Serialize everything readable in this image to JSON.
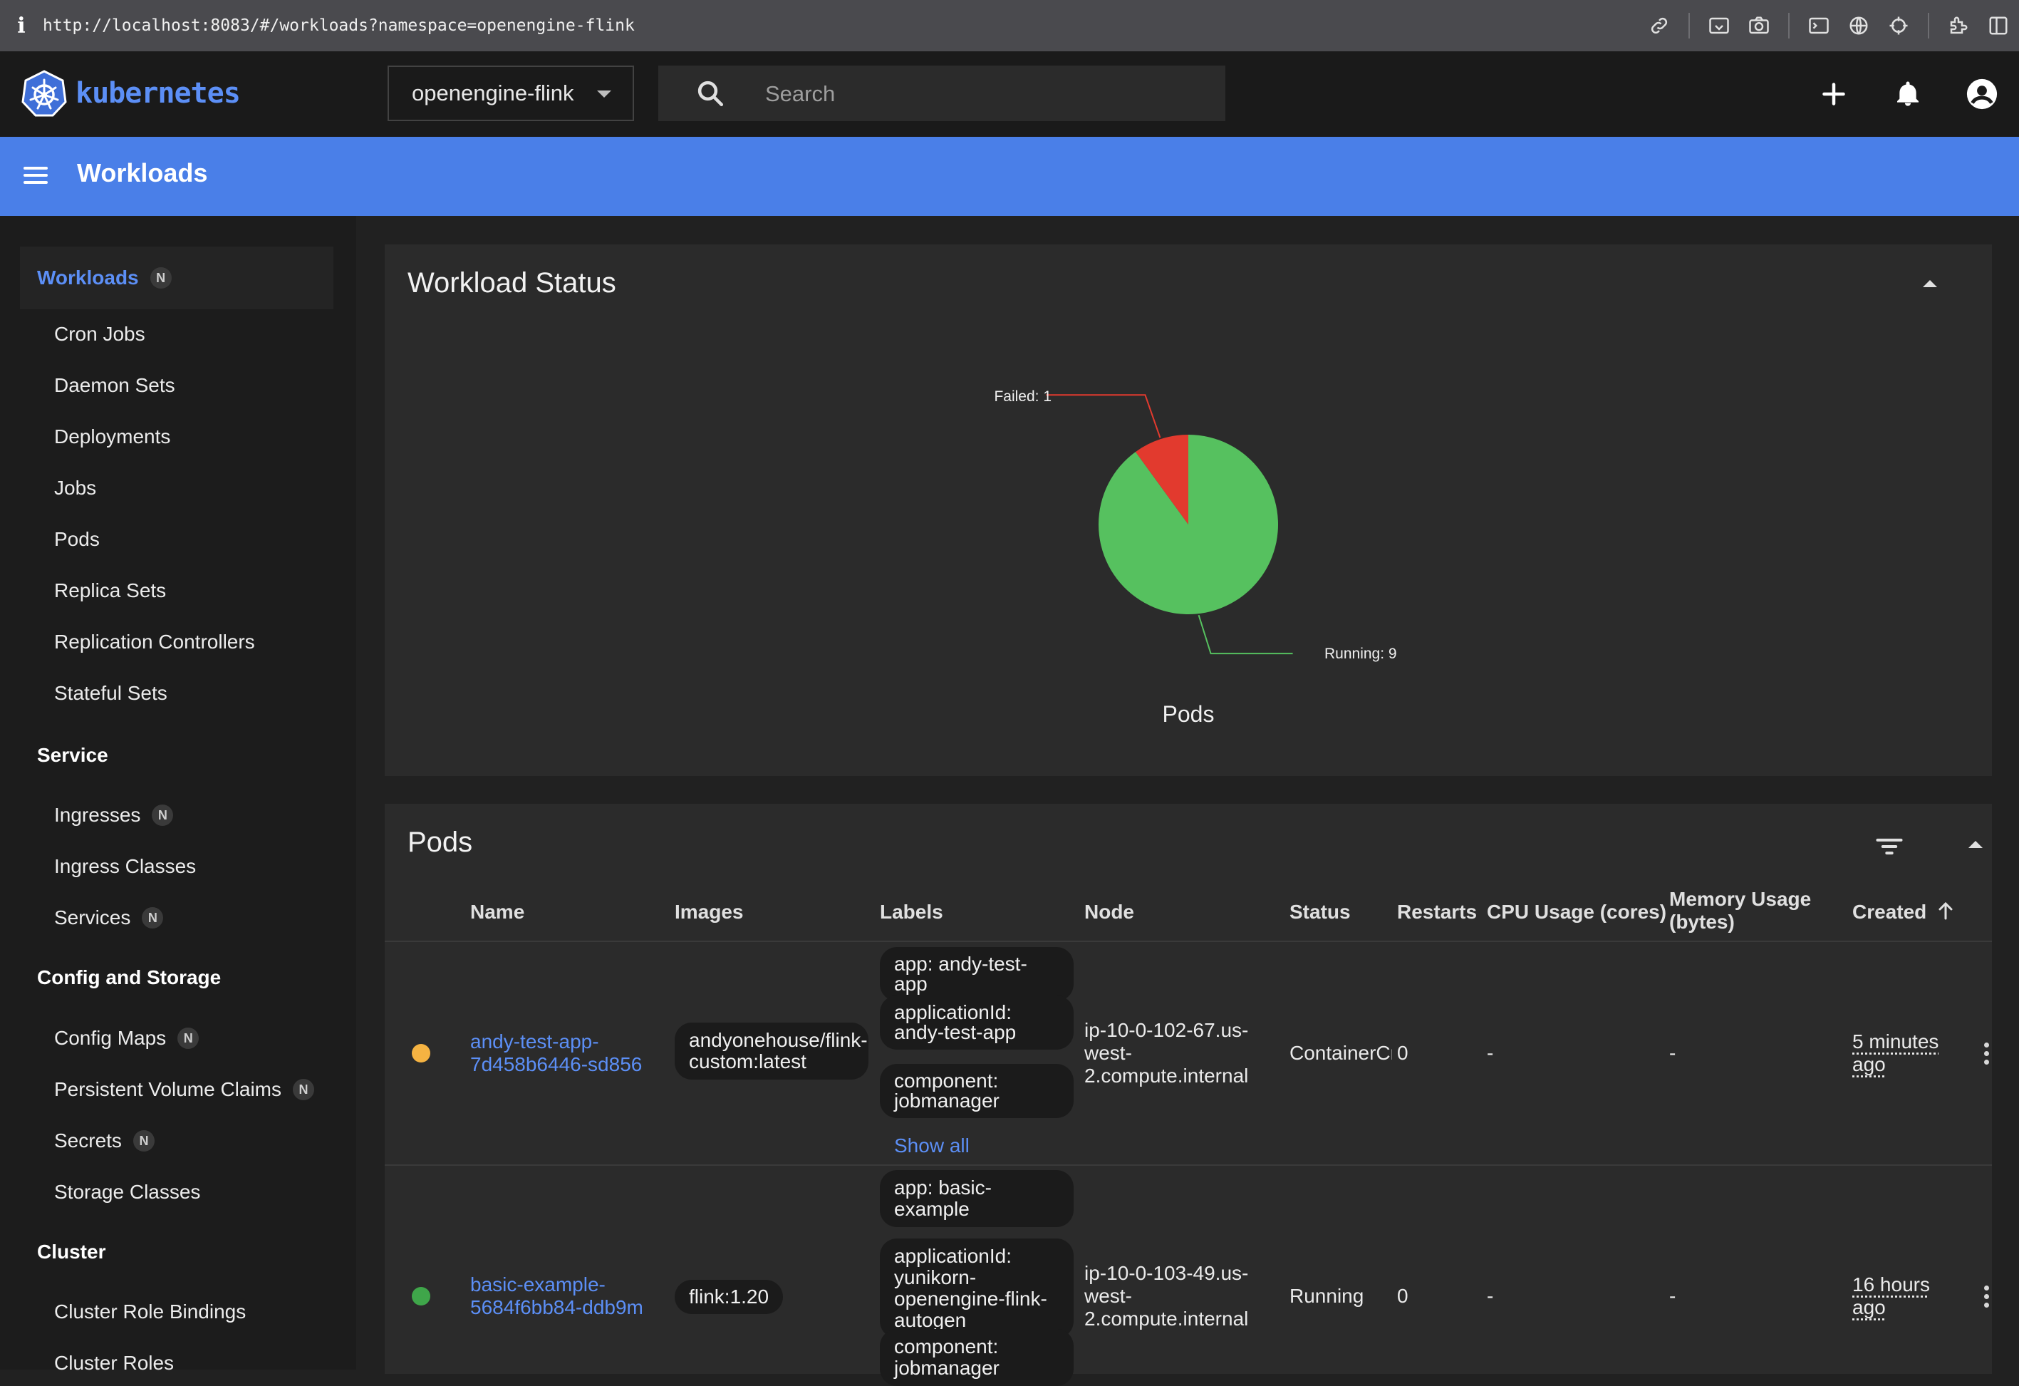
{
  "browser": {
    "info_glyph": "i",
    "url": "http://localhost:8083/#/workloads?namespace=openengine-flink",
    "tools": [
      "link-icon",
      "screenshot-icon",
      "camera-icon",
      "terminal-icon",
      "globe-icon",
      "crosshair-icon",
      "extension-icon",
      "sidebar-icon"
    ]
  },
  "header": {
    "logo_text": "kubernetes",
    "namespace": "openengine-flink",
    "search_placeholder": "Search",
    "actions": [
      "add-icon",
      "bell-icon",
      "account-icon"
    ]
  },
  "toolbar": {
    "title": "Workloads"
  },
  "sidebar": {
    "active": {
      "label": "Workloads",
      "badge": "N"
    },
    "workloads": [
      "Cron Jobs",
      "Daemon Sets",
      "Deployments",
      "Jobs",
      "Pods",
      "Replica Sets",
      "Replication Controllers",
      "Stateful Sets"
    ],
    "service_title": "Service",
    "service": [
      {
        "label": "Ingresses",
        "badge": "N"
      },
      {
        "label": "Ingress Classes",
        "badge": ""
      },
      {
        "label": "Services",
        "badge": "N"
      }
    ],
    "config_title": "Config and Storage",
    "config": [
      {
        "label": "Config Maps",
        "badge": "N"
      },
      {
        "label": "Persistent Volume Claims",
        "badge": "N"
      },
      {
        "label": "Secrets",
        "badge": "N"
      },
      {
        "label": "Storage Classes",
        "badge": ""
      }
    ],
    "cluster_title": "Cluster",
    "cluster": [
      "Cluster Role Bindings",
      "Cluster Roles"
    ]
  },
  "workload_status": {
    "title": "Workload Status",
    "colors": {
      "running": "#56c15f",
      "failed": "#e23a2e"
    }
  },
  "chart_data": {
    "type": "pie",
    "title": "Pods",
    "slices": [
      {
        "label": "Running",
        "value": 9,
        "text": "Running: 9",
        "color": "#56c15f"
      },
      {
        "label": "Failed",
        "value": 1,
        "text": "Failed: 1",
        "color": "#e23a2e"
      }
    ]
  },
  "pods": {
    "title": "Pods",
    "columns": {
      "name": "Name",
      "images": "Images",
      "labels": "Labels",
      "node": "Node",
      "status": "Status",
      "restarts": "Restarts",
      "cpu": "CPU Usage (cores)",
      "memory": "Memory Usage (bytes)",
      "created": "Created"
    },
    "rows": [
      {
        "status_color": "#f5b342",
        "name": "andy-test-app-7d458b6446-sd856",
        "image": "andyonehouse/flink-custom:latest",
        "labels": [
          "app: andy-test-app",
          "applicationId: andy-test-app",
          "component: jobmanager"
        ],
        "show_all": "Show all",
        "node": "ip-10-0-102-67.us-west-2.compute.internal",
        "status": "ContainerCreating",
        "restarts": "0",
        "cpu": "-",
        "memory": "-",
        "created": "5 minutes ago"
      },
      {
        "status_color": "#3fa64a",
        "name": "basic-example-5684f6bb84-ddb9m",
        "image": "flink:1.20",
        "labels": [
          "app: basic-example",
          "applicationId: yunikorn-openengine-flink-autogen",
          "component: jobmanager"
        ],
        "node": "ip-10-0-103-49.us-west-2.compute.internal",
        "status": "Running",
        "restarts": "0",
        "cpu": "-",
        "memory": "-",
        "created": "16 hours ago"
      }
    ]
  }
}
